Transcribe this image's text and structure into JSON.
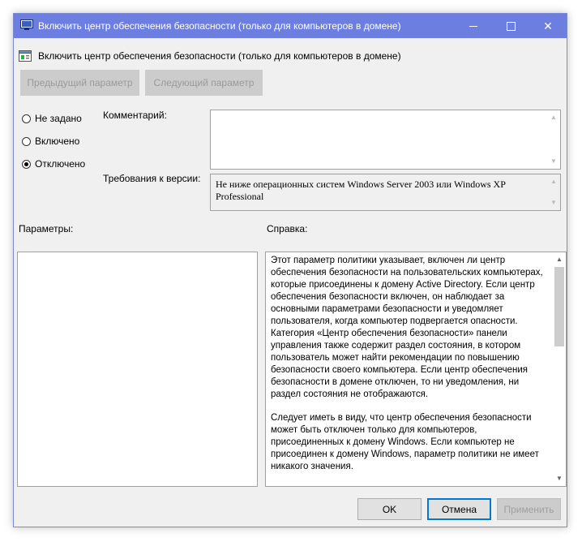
{
  "window": {
    "title": "Включить центр обеспечения безопасности (только для компьютеров в домене)",
    "controls": {
      "minimize": "minimize",
      "maximize": "maximize",
      "close": "✕"
    }
  },
  "header": {
    "title": "Включить центр обеспечения безопасности (только для компьютеров в домене)"
  },
  "nav": {
    "prev": "Предыдущий параметр",
    "next": "Следующий параметр"
  },
  "state_options": [
    {
      "label": "Не задано",
      "selected": false
    },
    {
      "label": "Включено",
      "selected": false
    },
    {
      "label": "Отключено",
      "selected": true
    }
  ],
  "comment": {
    "label": "Комментарий:",
    "value": ""
  },
  "version": {
    "label": "Требования к версии:",
    "value": "Не ниже операционных систем Windows Server 2003 или Windows XP Professional"
  },
  "params": {
    "label": "Параметры:"
  },
  "help": {
    "label": "Справка:",
    "paragraphs": [
      "Этот параметр политики указывает, включен ли центр обеспечения безопасности на пользовательских компьютерах, которые присоединены к домену Active Directory. Если центр обеспечения безопасности включен, он наблюдает за основными параметрами безопасности и уведомляет пользователя, когда компьютер подвергается опасности. Категория «Центр обеспечения безопасности» панели управления также содержит раздел состояния, в котором пользователь может найти рекомендации по повышению безопасности своего компьютера. Если центр обеспечения безопасности в домене отключен, то ни уведомления, ни раздел состояния не отображаются.",
      "Следует иметь в виду, что центр обеспечения безопасности может быть отключен только для компьютеров, присоединенных к домену Windows. Если компьютер не присоединен к домену Windows, параметр политики не имеет никакого значения."
    ]
  },
  "buttons": {
    "ok": "OK",
    "cancel": "Отмена",
    "apply": "Применить"
  },
  "colors": {
    "titlebar": "#6c7fe0",
    "focus_border": "#0078d7",
    "dialog_bg": "#f0f0f0"
  }
}
